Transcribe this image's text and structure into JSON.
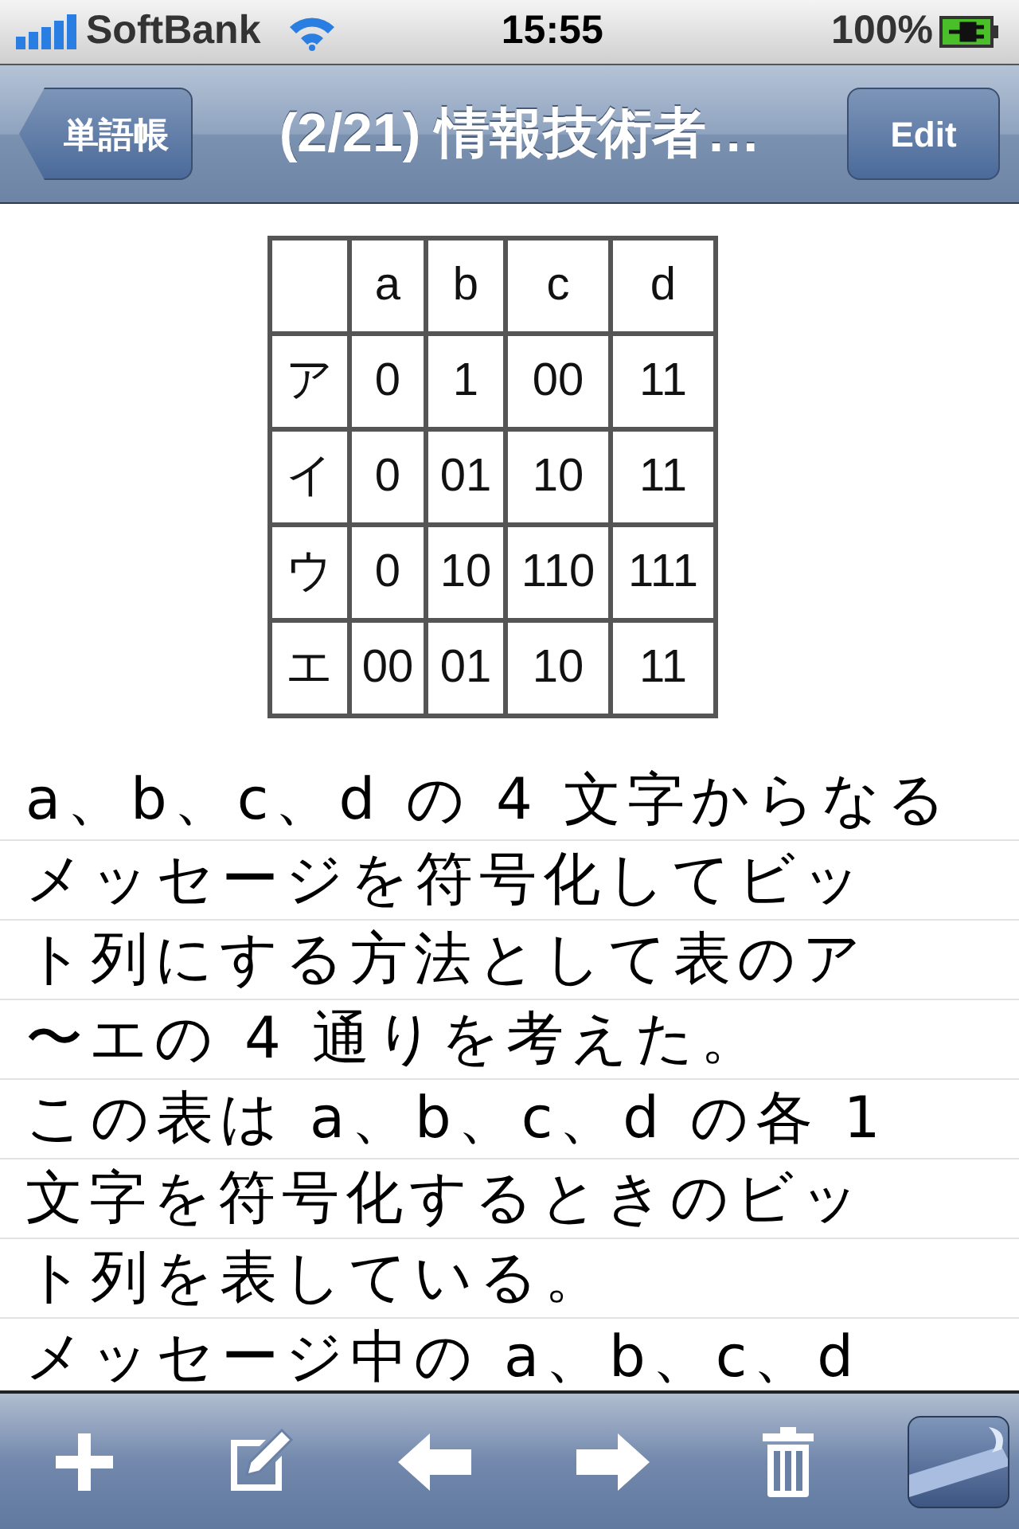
{
  "status_bar": {
    "carrier": "SoftBank",
    "time": "15:55",
    "battery": "100%"
  },
  "nav_bar": {
    "back_button": "単語帳",
    "title": "(2/21) 情報技術者…",
    "edit_button": "Edit"
  },
  "table": {
    "columns": [
      "a",
      "b",
      "c",
      "d"
    ],
    "rows": [
      {
        "label": "ア",
        "cells": [
          "0",
          "1",
          "00",
          "11"
        ]
      },
      {
        "label": "イ",
        "cells": [
          "0",
          "01",
          "10",
          "11"
        ]
      },
      {
        "label": "ウ",
        "cells": [
          "0",
          "10",
          "110",
          "111"
        ]
      },
      {
        "label": "エ",
        "cells": [
          "00",
          "01",
          "10",
          "11"
        ]
      }
    ]
  },
  "body_lines": [
    "a、b、c、d の 4 文字からなる",
    "メッセージを符号化してビッ",
    "ト列にする方法として表のア",
    "〜エの 4 通りを考えた。",
    "この表は a、b、c、d の各 1",
    "文字を符号化するときのビッ",
    "ト列を表している。",
    "メッセージ中の a、b、c、d"
  ],
  "toolbar": [
    {
      "kind": "add"
    },
    {
      "kind": "compose"
    },
    {
      "kind": "back"
    },
    {
      "kind": "forward"
    },
    {
      "kind": "trash"
    },
    {
      "kind": "curl"
    }
  ]
}
